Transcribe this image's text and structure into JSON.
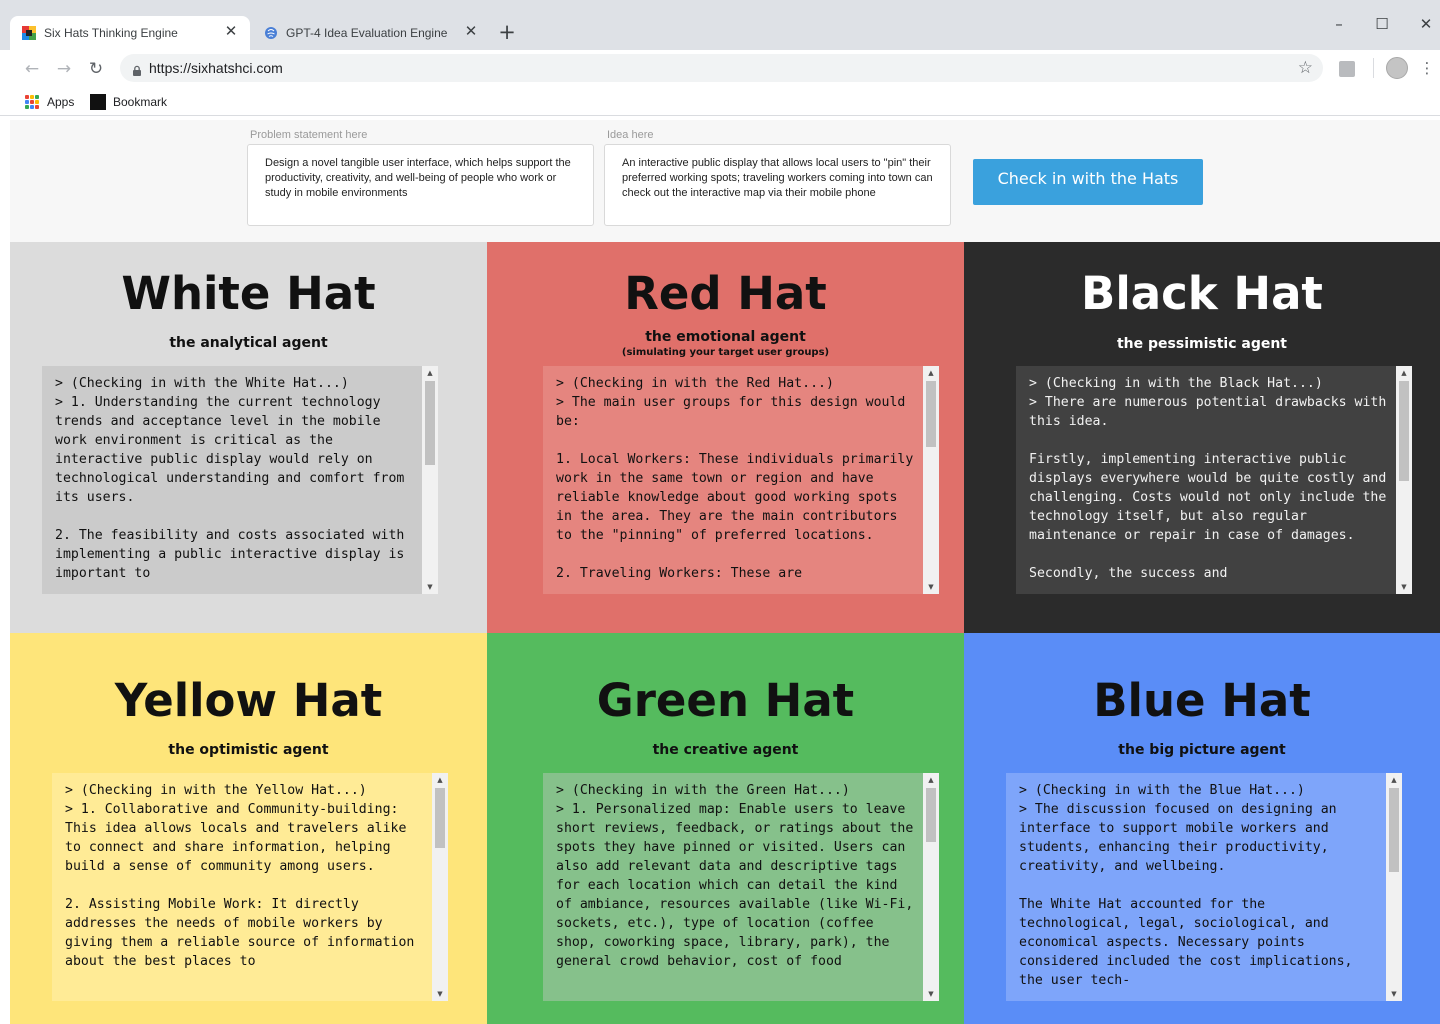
{
  "browser": {
    "tabs": [
      {
        "title": "Six Hats Thinking Engine",
        "active": true
      },
      {
        "title": "GPT-4 Idea Evaluation Engine",
        "active": false
      }
    ],
    "new_tab_symbol": "+",
    "close_symbol": "✕",
    "url": "https://sixhatshci.com",
    "window_controls": {
      "minimize": "–",
      "maximize": "☐",
      "close": "✕"
    },
    "bookmarks": [
      {
        "label": "Apps",
        "icon": "apps-grid-icon"
      },
      {
        "label": "Bookmark",
        "icon": "bookmark-square-icon"
      }
    ]
  },
  "inputs": {
    "problem": {
      "label": "Problem statement here",
      "value": "Design a novel tangible user interface, which helps support the productivity, creativity, and well-being of people who work or study in mobile environments"
    },
    "idea": {
      "label": "Idea here",
      "value": "An interactive public display that allows local users to \"pin\" their preferred working spots; traveling workers coming into town can check out the interactive map via their mobile phone"
    },
    "submit_label": "Check in with the Hats",
    "accent_color": "#3aa1dd"
  },
  "hats": {
    "white": {
      "title": "White Hat",
      "subtitle": "the analytical agent",
      "color": "#dcdcdc",
      "output": "> (Checking in with the White Hat...)\n> 1. Understanding the current technology trends and acceptance level in the mobile work environment is critical as the interactive public display would rely on technological understanding and comfort from its users.\n\n2. The feasibility and costs associated with implementing a public interactive display is important to"
    },
    "red": {
      "title": "Red Hat",
      "subtitle": "the emotional agent",
      "note": "(simulating your target user groups)",
      "color": "#e0706a",
      "output": "> (Checking in with the Red Hat...)\n> The main user groups for this design would be:\n\n1. Local Workers: These individuals primarily work in the same town or region and have reliable knowledge about good working spots in the area. They are the main contributors to the \"pinning\" of preferred locations.\n\n2. Traveling Workers: These are"
    },
    "black": {
      "title": "Black Hat",
      "subtitle": "the pessimistic agent",
      "color": "#2b2b2b",
      "output": "> (Checking in with the Black Hat...)\n> There are numerous potential drawbacks with this idea.\n\nFirstly, implementing interactive public displays everywhere would be quite costly and challenging. Costs would not only include the technology itself, but also regular maintenance or repair in case of damages.\n\nSecondly, the success and"
    },
    "yellow": {
      "title": "Yellow Hat",
      "subtitle": "the optimistic agent",
      "color": "#fee57a",
      "output": "> (Checking in with the Yellow Hat...)\n> 1. Collaborative and Community-building: This idea allows locals and travelers alike to connect and share information, helping build a sense of community among users.\n\n2. Assisting Mobile Work: It directly addresses the needs of mobile workers by giving them a reliable source of information about the best places to"
    },
    "green": {
      "title": "Green Hat",
      "subtitle": "the creative agent",
      "color": "#55bb5e",
      "output": "> (Checking in with the Green Hat...)\n> 1. Personalized map: Enable users to leave short reviews, feedback, or ratings about the spots they have pinned or visited. Users can also add relevant data and descriptive tags for each location which can detail the kind of ambiance, resources available (like Wi-Fi, sockets, etc.), type of location (coffee shop, coworking space, library, park), the general crowd behavior, cost of food"
    },
    "blue": {
      "title": "Blue Hat",
      "subtitle": "the big picture agent",
      "color": "#5a8df7",
      "output": "> (Checking in with the Blue Hat...)\n> The discussion focused on designing an interface to support mobile workers and students, enhancing their productivity, creativity, and wellbeing.\n\nThe White Hat accounted for the technological, legal, sociological, and economical aspects. Necessary points considered included the cost implications, the user tech-"
    }
  }
}
